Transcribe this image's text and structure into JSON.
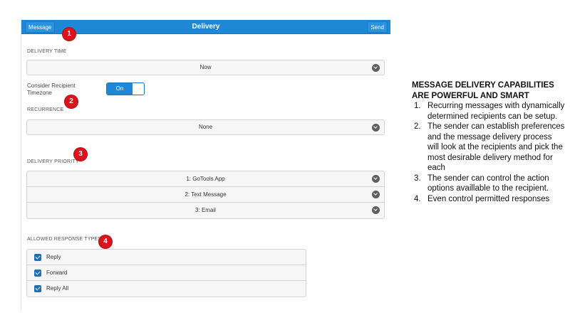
{
  "header": {
    "left_button": "Message",
    "title": "Delivery",
    "right_button": "Send"
  },
  "delivery_time": {
    "label": "DELIVERY TIME",
    "value": "Now"
  },
  "timezone": {
    "label": "Consider Recipient Timezone",
    "toggle_state": "On"
  },
  "recurrence": {
    "label": "RECURRENCE",
    "value": "None"
  },
  "delivery_priority": {
    "label": "DELIVERY PRIORITY",
    "items": [
      "1: GoTools App",
      "2: Text Message",
      "3: Email"
    ]
  },
  "response_types": {
    "label": "ALLOWED RESPONSE TYPES",
    "items": [
      {
        "label": "Reply",
        "checked": true
      },
      {
        "label": "Forward",
        "checked": true
      },
      {
        "label": "Reply All",
        "checked": true
      }
    ]
  },
  "badges": [
    "1",
    "2",
    "3",
    "4"
  ],
  "notes": {
    "title": "MESSAGE DELIVERY CAPABILITIES ARE POWERFUL AND SMART",
    "items": [
      {
        "num": "1.",
        "text": "Recurring messages with dynamically determined recipients can be setup."
      },
      {
        "num": "2.",
        "text": "The sender can establish preferences and the message delivery process will look at the recipients and pick the most desirable delivery method for each"
      },
      {
        "num": "3.",
        "text": "The sender can control the action options availlable to the recipient."
      },
      {
        "num": "4.",
        "text": "Even control permitted responses"
      }
    ]
  },
  "colors": {
    "header_blue": "#1e88d6",
    "badge_red": "#d9141c",
    "checkbox_blue": "#1e6fb8"
  }
}
